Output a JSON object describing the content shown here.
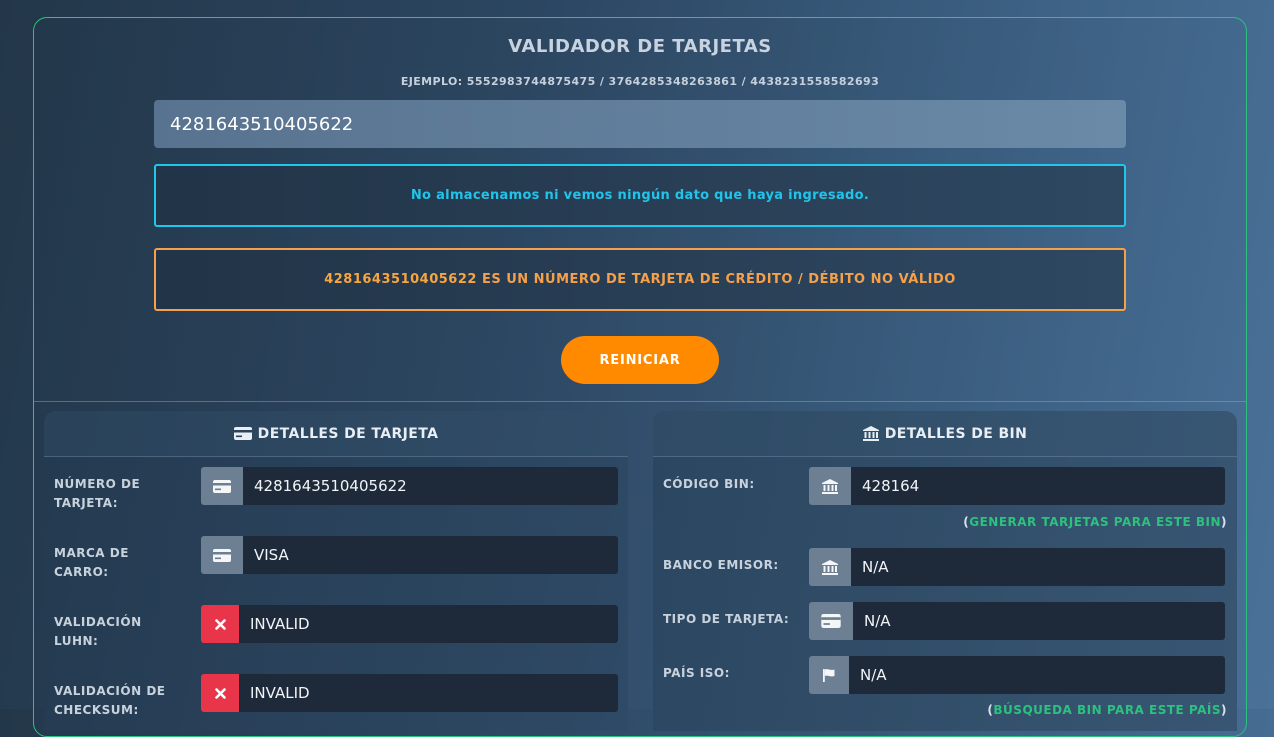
{
  "header": {
    "title": "VALIDADOR DE TARJETAS",
    "example": "EJEMPLO: 5552983744875475 / 3764285348263861 / 4438231558582693"
  },
  "input": {
    "value": "4281643510405622"
  },
  "notice": "No almacenamos ni vemos ningún dato que haya ingresado.",
  "result": {
    "number": "4281643510405622",
    "message": "ES UN NÚMERO DE TARJETA DE CRÉDITO / DÉBITO NO VÁLIDO"
  },
  "reset_label": "REINICIAR",
  "card_details": {
    "title": "DETALLES DE TARJETA",
    "rows": [
      {
        "label": "NÚMERO DE TARJETA:",
        "value": "4281643510405622",
        "icon": "credit-card-icon"
      },
      {
        "label": "MARCA DE CARRO:",
        "value": "VISA",
        "icon": "credit-card-icon"
      },
      {
        "label": "VALIDACIÓN LUHN:",
        "value": "INVALID",
        "icon": "x-icon"
      },
      {
        "label": "VALIDACIÓN DE CHECKSUM:",
        "value": "INVALID",
        "icon": "x-icon"
      }
    ]
  },
  "bin_details": {
    "title": "DETALLES DE BIN",
    "rows": [
      {
        "label": "CÓDIGO BIN:",
        "value": "428164",
        "icon": "bank-icon"
      },
      {
        "label": "BANCO EMISOR:",
        "value": "N/A",
        "icon": "bank-icon"
      },
      {
        "label": "TIPO DE TARJETA:",
        "value": "N/A",
        "icon": "credit-card-icon"
      },
      {
        "label": "PAÍS ISO:",
        "value": "N/A",
        "icon": "flag-icon"
      }
    ],
    "generate_link": "GENERAR TARJETAS PARA ESTE BIN",
    "search_link": "BÚSQUEDA BIN PARA ESTE PAÍS"
  },
  "colors": {
    "accent_green": "#2cc27e",
    "notice_cyan": "#1ec8ea",
    "warning_orange": "#f5a04a",
    "button_orange": "#ff8a00",
    "invalid_red": "#e8354a"
  }
}
